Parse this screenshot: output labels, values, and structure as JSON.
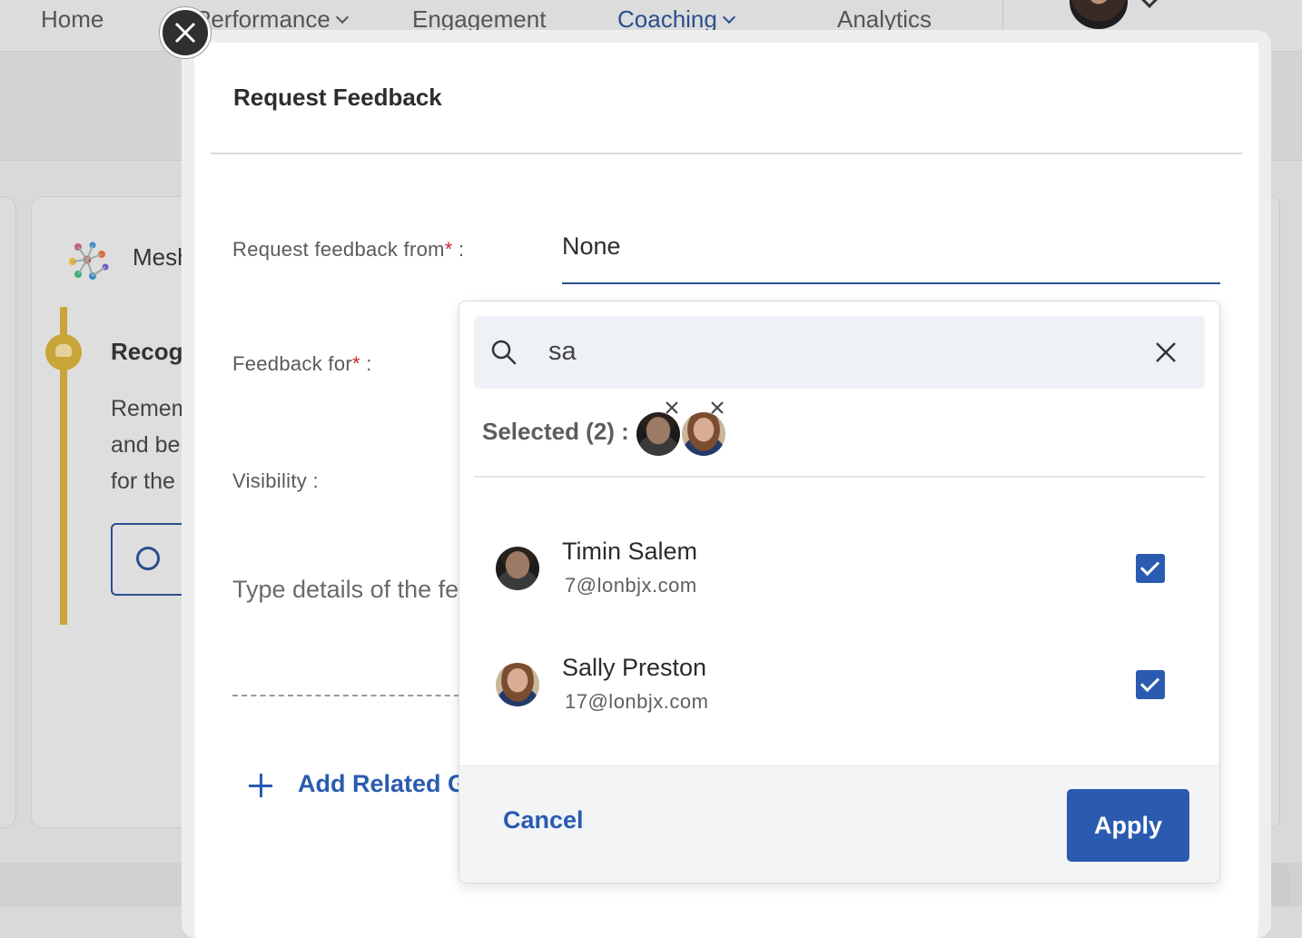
{
  "nav": {
    "items": [
      {
        "label": "Home",
        "active": false
      },
      {
        "label": "Performance",
        "active": false
      },
      {
        "label": "Engagement",
        "active": false
      },
      {
        "label": "Coaching",
        "active": true
      },
      {
        "label": "Analytics",
        "active": false
      }
    ]
  },
  "background": {
    "card_title": "Mesh",
    "section_title": "Recognition",
    "text_lines": [
      "Remember",
      "and be",
      "for the"
    ]
  },
  "modal": {
    "title": "Request Feedback",
    "request_from_label": "Request feedback from",
    "request_from_value": "None",
    "feedback_for_label": "Feedback for",
    "visibility_label": "Visibility :",
    "required_mark": "*",
    "label_colon": " :",
    "details_placeholder": "Type details of the feedback",
    "add_goal_label": "Add Related Goal"
  },
  "dropdown": {
    "search_value": "sa",
    "selected_label": "Selected (2) :",
    "people": [
      {
        "name": "Timin Salem",
        "email": "7@lonbjx.com",
        "checked": true,
        "avatar": "male-portrait"
      },
      {
        "name": "Sally Preston",
        "email": "17@lonbjx.com",
        "checked": true,
        "avatar": "female-portrait"
      }
    ],
    "cancel_label": "Cancel",
    "apply_label": "Apply"
  },
  "icons": {
    "close": "close-icon",
    "search": "search-icon",
    "clear": "clear-icon",
    "plus": "plus-icon",
    "chevron": "chevron-down-icon"
  },
  "colors": {
    "accent": "#2a5bb0",
    "nav_active": "#2a4f8f",
    "required": "#d2283a",
    "timeline": "#c9a438"
  }
}
